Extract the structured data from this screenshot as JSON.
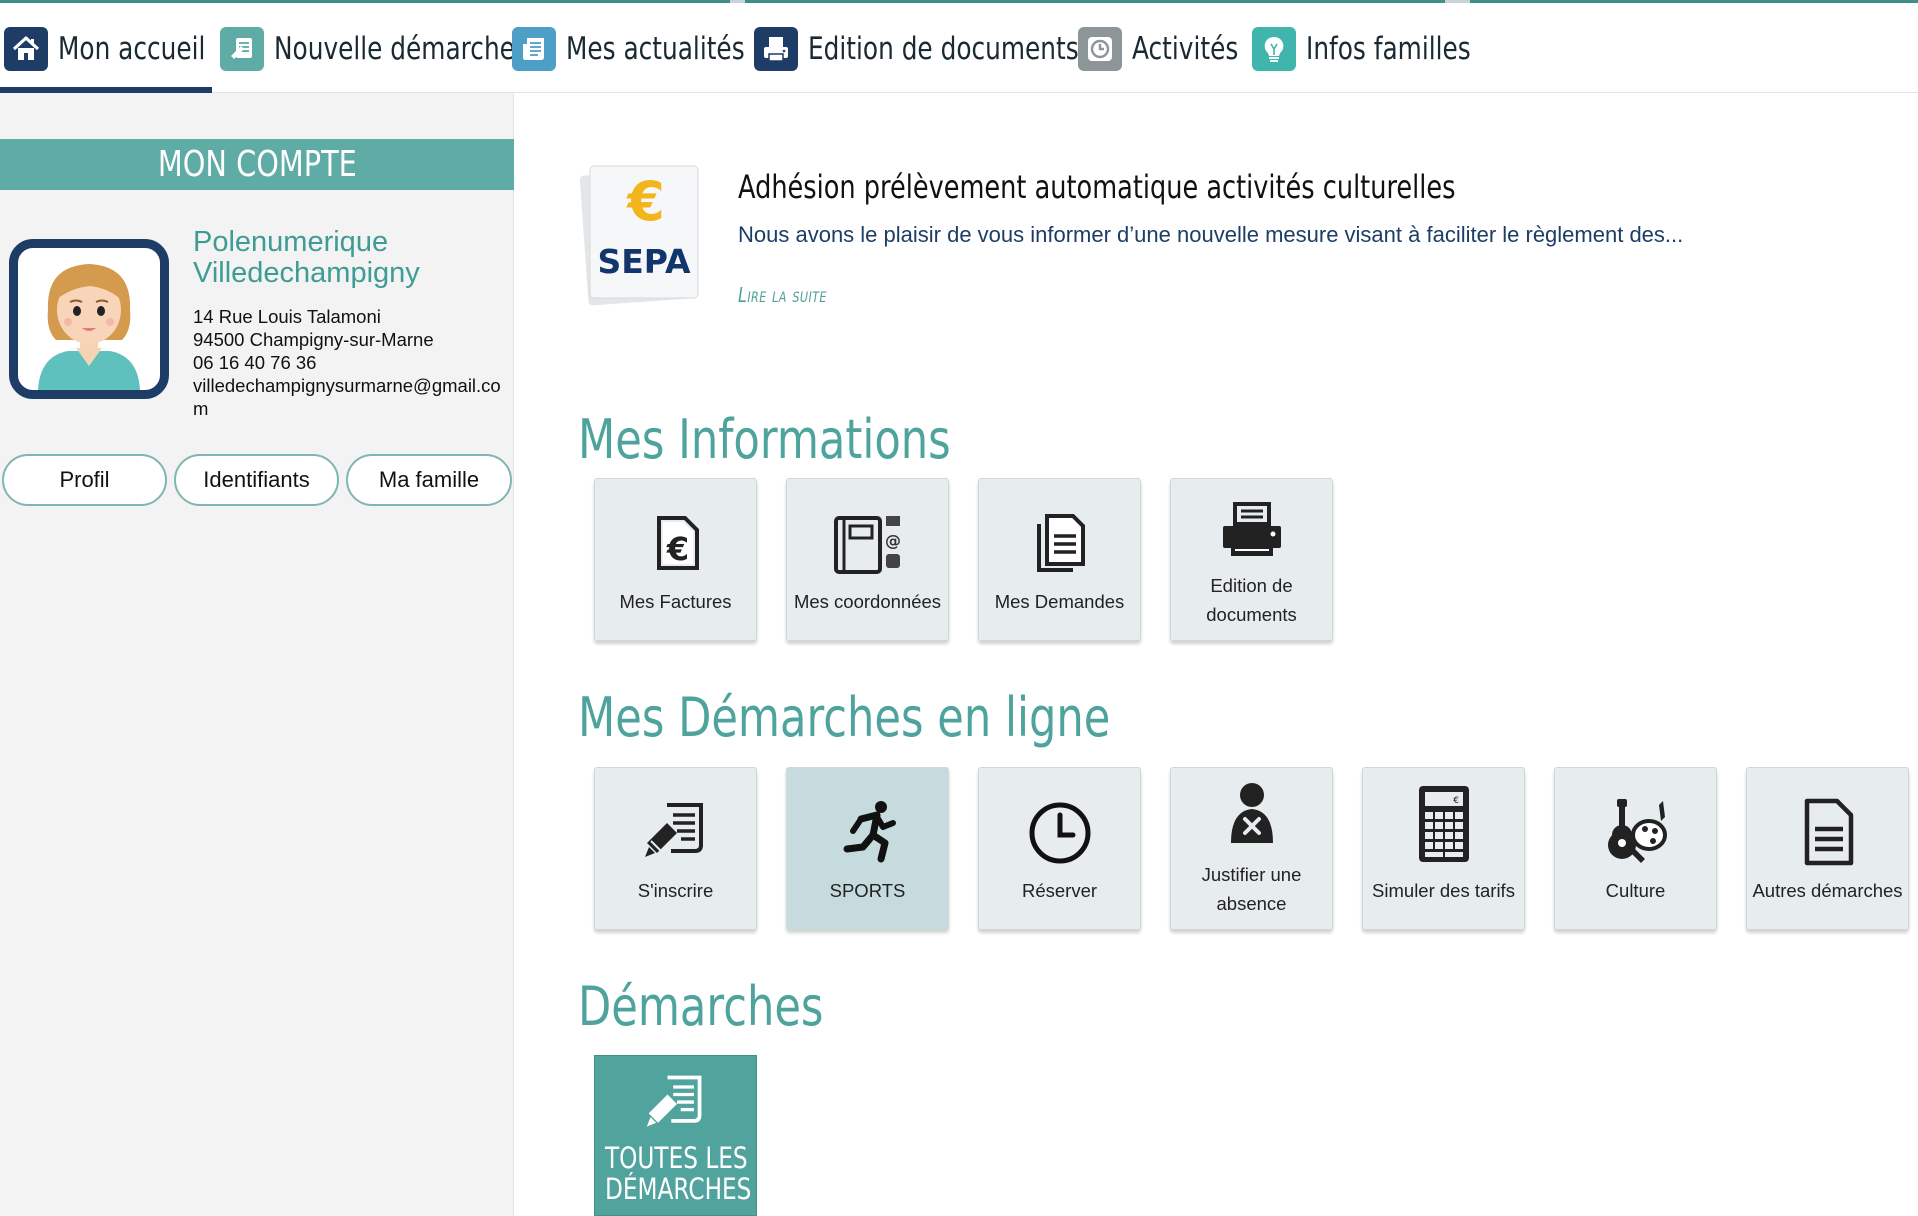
{
  "colors": {
    "teal": "#5eaca5",
    "navy": "#1d3d66",
    "tile_bg": "#e7edef",
    "tile_highlight": "#c5dbde"
  },
  "nav": {
    "items": [
      {
        "label": "Mon accueil",
        "icon": "home-icon",
        "active": true
      },
      {
        "label": "Nouvelle démarche",
        "icon": "form-icon"
      },
      {
        "label": "Mes actualités",
        "icon": "news-icon"
      },
      {
        "label": "Edition de documents",
        "icon": "printer-icon"
      },
      {
        "label": "Activités",
        "icon": "clock-icon"
      },
      {
        "label": "Infos familles",
        "icon": "lightbulb-icon"
      }
    ]
  },
  "account": {
    "header": "MON COMPTE",
    "name_line1": "Polenumerique",
    "name_line2": "Villedechampigny",
    "street": "14 Rue Louis Talamoni",
    "city": "94500 Champigny-sur-Marne",
    "phone": "06 16 40 76 36",
    "email": "villedechampignysurmarne@gmail.com",
    "buttons": [
      "Profil",
      "Identifiants",
      "Ma famille"
    ]
  },
  "news": {
    "logo_text": "SEPA",
    "logo_symbol": "€",
    "title": "Adhésion prélèvement automatique activités culturelles",
    "text": "Nous avons le plaisir de vous informer d’une nouvelle mesure visant à faciliter le règlement des...",
    "link": "Lire la suite"
  },
  "sections": {
    "infos": {
      "title": "Mes Informations",
      "tiles": [
        {
          "label": "Mes Factures",
          "icon": "invoice-euro-icon"
        },
        {
          "label": "Mes coordonnées",
          "icon": "contact-book-icon"
        },
        {
          "label": "Mes Demandes",
          "icon": "documents-icon"
        },
        {
          "label": "Edition de documents",
          "icon": "printer-icon"
        }
      ]
    },
    "online": {
      "title": "Mes Démarches en ligne",
      "tiles": [
        {
          "label": "S'inscrire",
          "icon": "signup-form-icon"
        },
        {
          "label": "SPORTS",
          "icon": "running-person-icon",
          "highlighted": true
        },
        {
          "label": "Réserver",
          "icon": "clock-icon"
        },
        {
          "label": "Justifier une absence",
          "icon": "absent-person-icon"
        },
        {
          "label": "Simuler des tarifs",
          "icon": "calculator-icon"
        },
        {
          "label": "Culture",
          "icon": "guitar-palette-icon"
        },
        {
          "label": "Autres démarches",
          "icon": "document-icon"
        }
      ]
    },
    "demarches": {
      "title": "Démarches",
      "tile_line1": "TOUTES LES",
      "tile_line2": "DÉMARCHES",
      "tile_icon": "signup-form-icon"
    }
  }
}
